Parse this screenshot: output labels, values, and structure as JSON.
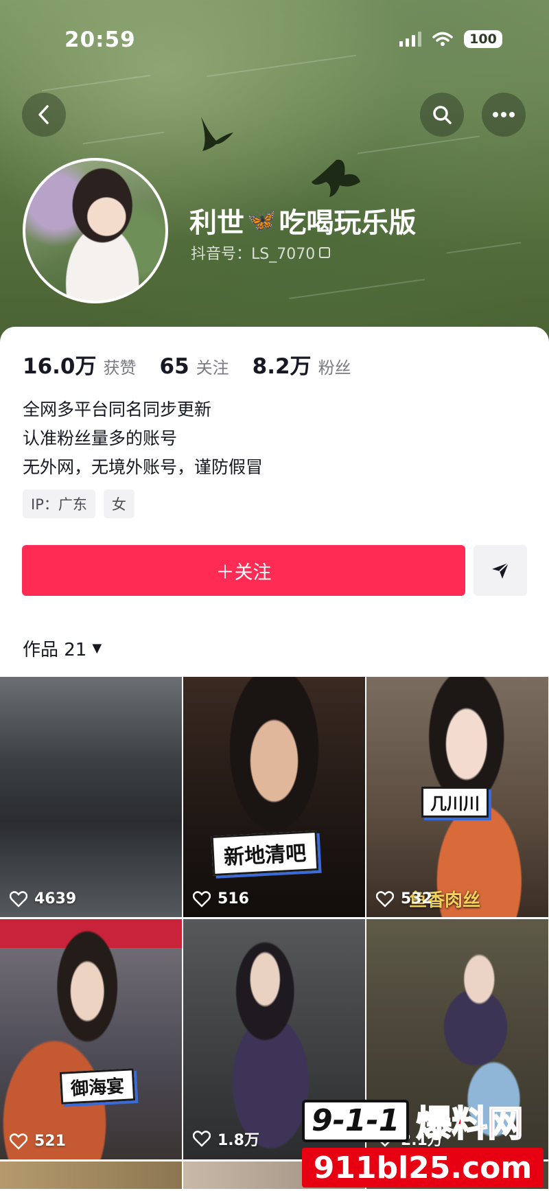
{
  "status_bar": {
    "time": "20:59",
    "battery": "100"
  },
  "profile": {
    "name_part1": "利世",
    "name_emoji": "🦋",
    "name_part2": "吃喝玩乐版",
    "douyin_id": "抖音号：LS_7070"
  },
  "stats": [
    {
      "value": "16.0万",
      "label": "获赞"
    },
    {
      "value": "65",
      "label": "关注"
    },
    {
      "value": "8.2万",
      "label": "粉丝"
    }
  ],
  "bio": [
    "全网多平台同名同步更新",
    "认准粉丝量多的账号",
    "无外网，无境外账号，谨防假冒"
  ],
  "tags": [
    "IP：广东",
    "女"
  ],
  "actions": {
    "follow_label": "＋关注"
  },
  "works": {
    "label": "作品 21",
    "caret": "▼"
  },
  "videos": [
    {
      "likes": "4639",
      "sticker": ""
    },
    {
      "likes": "516",
      "sticker": "新地清吧"
    },
    {
      "likes": "532",
      "sticker": "几川川",
      "caption": "鱼香肉丝"
    },
    {
      "likes": "521",
      "sticker": "御海宴"
    },
    {
      "likes": "1.8万",
      "sticker": ""
    },
    {
      "likes": "2.1万",
      "sticker": ""
    }
  ],
  "watermark": {
    "box": "9-1-1",
    "text": "爆料网",
    "url": "911bl25.com"
  },
  "colors": {
    "accent": "#fe2c55",
    "watermark_red": "#e60012"
  }
}
